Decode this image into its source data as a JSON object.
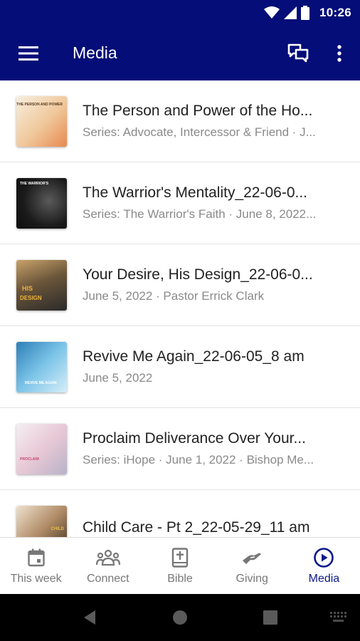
{
  "status_bar": {
    "time": "10:26"
  },
  "app_bar": {
    "title": "Media"
  },
  "media_items": [
    {
      "title": "The Person and Power of the Ho...",
      "subtitle": "Series: Advocate, Intercessor & Friend · J...",
      "thumb_colors": [
        "#e9d6b8",
        "#f2a96a"
      ]
    },
    {
      "title": "The Warrior's Mentality_22-06-0...",
      "subtitle": "Series: The Warrior's Faith · June 8, 2022...",
      "thumb_colors": [
        "#1b1b1b",
        "#3b3b3b"
      ]
    },
    {
      "title": "Your Desire, His Design_22-06-0...",
      "subtitle": "June 5, 2022 · Pastor Errick Clark",
      "thumb_colors": [
        "#6c5a3e",
        "#2c2c2c"
      ]
    },
    {
      "title": "Revive Me Again_22-06-05_8 am",
      "subtitle": "June 5, 2022",
      "thumb_colors": [
        "#3a8fc7",
        "#9dd3ef"
      ]
    },
    {
      "title": "Proclaim Deliverance Over Your...",
      "subtitle": "Series: iHope · June 1, 2022 · Bishop Me...",
      "thumb_colors": [
        "#f1e7ee",
        "#c9486f"
      ]
    },
    {
      "title": "Child Care - Pt 2_22-05-29_11 am",
      "subtitle": "",
      "thumb_colors": [
        "#d8c3a8",
        "#3a2a1f"
      ]
    }
  ],
  "bottom_nav": [
    {
      "label": "This week",
      "icon": "calendar-icon",
      "active": false
    },
    {
      "label": "Connect",
      "icon": "people-icon",
      "active": false
    },
    {
      "label": "Bible",
      "icon": "bible-icon",
      "active": false
    },
    {
      "label": "Giving",
      "icon": "giving-hand-icon",
      "active": false
    },
    {
      "label": "Media",
      "icon": "play-circle-icon",
      "active": true
    }
  ],
  "colors": {
    "primary": "#040d78",
    "active_nav": "#0c1a8a",
    "inactive_nav": "#777777"
  }
}
